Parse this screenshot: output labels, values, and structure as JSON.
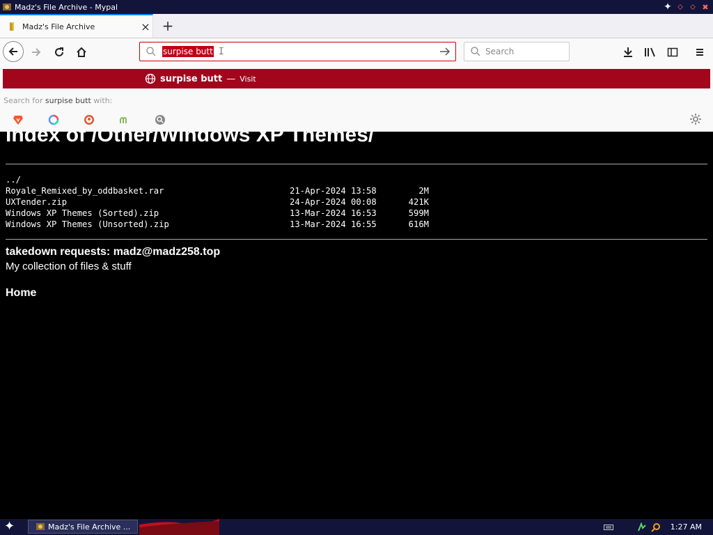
{
  "window": {
    "title": "Madz's File Archive - Mypal"
  },
  "tab": {
    "title": "Madz's File Archive",
    "close": "×",
    "new": "+"
  },
  "urlbar": {
    "value": "surpise butt"
  },
  "searchbar": {
    "placeholder": "Search"
  },
  "popup": {
    "suggestion": "surpise butt",
    "dash": "—",
    "action": "Visit",
    "search_for_prefix": "Search for ",
    "search_for_term": "surpise butt",
    "search_for_suffix": " with:",
    "engines": [
      "brave-icon",
      "qwant-icon",
      "duckduckgo-icon",
      "mojeek-icon",
      "search-engine-icon"
    ]
  },
  "page": {
    "heading": "Index of /Other/Windows XP Themes/",
    "parent": "../",
    "files": [
      {
        "name": "Royale_Remixed_by_oddbasket.rar",
        "date": "21-Apr-2024 13:58",
        "size": "2M"
      },
      {
        "name": "UXTender.zip",
        "date": "24-Apr-2024 00:08",
        "size": "421K"
      },
      {
        "name": "Windows XP Themes (Sorted).zip",
        "date": "13-Mar-2024 16:53",
        "size": "599M"
      },
      {
        "name": "Windows XP Themes (Unsorted).zip",
        "date": "13-Mar-2024 16:55",
        "size": "616M"
      }
    ],
    "takedown": "takedown requests: madz@madz258.top",
    "collection": "My collection of files & stuff",
    "home": "Home"
  },
  "taskbar": {
    "task_title": "Madz's File Archive ...",
    "clock": "1:27 AM"
  },
  "colors": {
    "accent": "#a1061d",
    "titlebar": "#12143a",
    "page_bg": "#000000"
  }
}
